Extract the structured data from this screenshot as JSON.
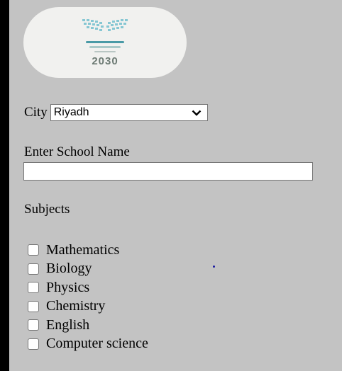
{
  "logo": {
    "text_2030": "2030",
    "icon": "ministry-of-education-book-icon",
    "colors": {
      "book": "#86c7d3",
      "text": "#4a9aa6",
      "numerals": "#6c7a73"
    }
  },
  "city": {
    "label": "City",
    "selected": "Riyadh"
  },
  "school": {
    "label": "Enter School Name",
    "value": ""
  },
  "subjects": {
    "label": "Subjects",
    "items": [
      {
        "label": "Mathematics",
        "checked": false
      },
      {
        "label": "Biology",
        "checked": false
      },
      {
        "label": "Physics",
        "checked": false
      },
      {
        "label": "Chemistry",
        "checked": false
      },
      {
        "label": "English",
        "checked": false
      },
      {
        "label": "Computer science",
        "checked": false
      }
    ]
  }
}
